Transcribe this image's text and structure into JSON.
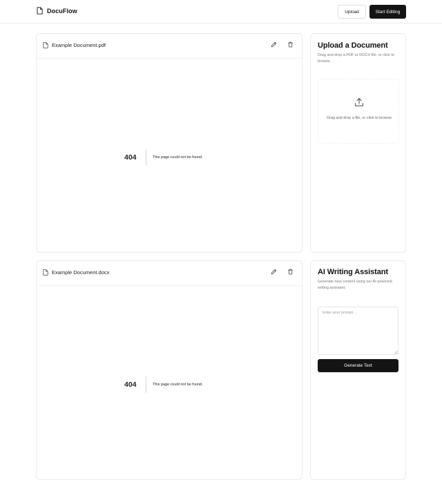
{
  "app": {
    "name": "DocuFlow",
    "logo_icon": "file-icon"
  },
  "header": {
    "upload_label": "Upload",
    "start_editing_label": "Start Editing"
  },
  "documents": [
    {
      "name": "Example Document.pdf",
      "file_icon": "file-icon",
      "actions": [
        "pencil-icon",
        "trash-icon"
      ],
      "error_code": "404",
      "error_message": "This page could not be found."
    },
    {
      "name": "Example Document.docx",
      "file_icon": "file-icon",
      "actions": [
        "pencil-icon",
        "trash-icon"
      ],
      "error_code": "404",
      "error_message": "This page could not be found."
    }
  ],
  "upload": {
    "title": "Upload a Document",
    "description": "Drag and drop a PDF or DOCX file, or click to browse.",
    "dropzone_icon": "upload-icon",
    "dropzone_text": "Drag and drop a file, or click to browse"
  },
  "assistant": {
    "title": "AI Writing Assistant",
    "description": "Generate new content using our AI-powered writing assistant.",
    "prompt_placeholder": "Enter your prompt...",
    "prompt_value": "",
    "generate_label": "Generate Text"
  },
  "colors": {
    "primary_button": "#141414",
    "border": "#ebebeb",
    "muted_text": "#777777"
  }
}
